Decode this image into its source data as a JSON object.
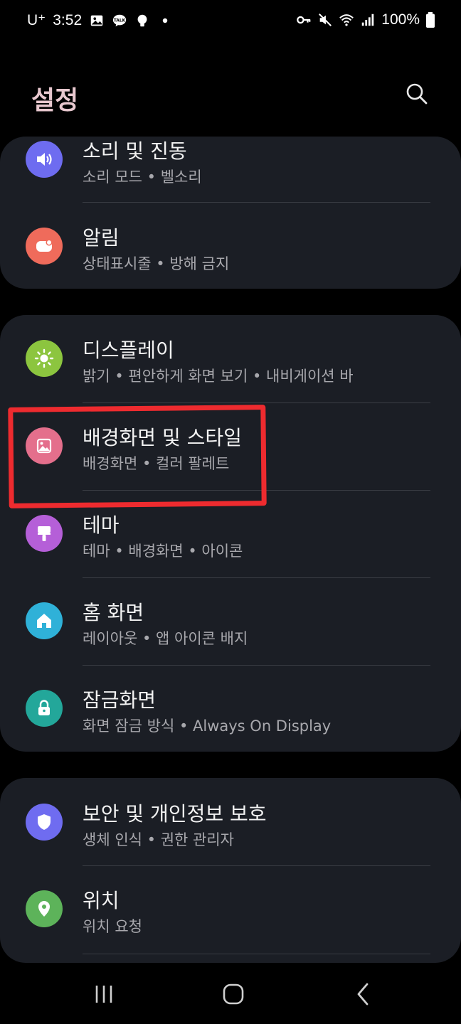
{
  "status_bar": {
    "carrier": "U⁺",
    "time": "3:52",
    "battery": "100%",
    "left_icons": [
      "gallery-icon",
      "kakaotalk-icon",
      "bulb-icon",
      "dot-icon"
    ],
    "right_icons": [
      "key-icon",
      "mute-icon",
      "wifi-icon",
      "signal-icon",
      "battery-icon"
    ],
    "kakao_label": "TALK"
  },
  "header": {
    "title": "설정",
    "search_icon": "search-icon"
  },
  "groups": [
    {
      "items": [
        {
          "title": "소리 및 진동",
          "subtitle": "소리 모드 • 벨소리",
          "icon": "sound-icon",
          "color": "#6e6cf0"
        },
        {
          "title": "알림",
          "subtitle": "상태표시줄 • 방해 금지",
          "icon": "notification-icon",
          "color": "#ef6b5b"
        }
      ]
    },
    {
      "items": [
        {
          "title": "디스플레이",
          "subtitle": "밝기 • 편안하게 화면 보기 • 내비게이션 바",
          "icon": "display-icon",
          "color": "#8cc53f"
        },
        {
          "title": "배경화면 및 스타일",
          "subtitle": "배경화면 • 컬러 팔레트",
          "icon": "wallpaper-icon",
          "color": "#e46f8c"
        },
        {
          "title": "테마",
          "subtitle": "테마 • 배경화면 • 아이콘",
          "icon": "theme-icon",
          "color": "#b55fd8"
        },
        {
          "title": "홈 화면",
          "subtitle": "레이아웃 • 앱 아이콘 배지",
          "icon": "home-icon",
          "color": "#2fb1d8"
        },
        {
          "title": "잠금화면",
          "subtitle": "화면 잠금 방식 • Always On Display",
          "icon": "lock-icon",
          "color": "#23a79a"
        }
      ]
    },
    {
      "items": [
        {
          "title": "보안 및 개인정보 보호",
          "subtitle": "생체 인식 • 권한 관리자",
          "icon": "shield-icon",
          "color": "#6f6cf0"
        },
        {
          "title": "위치",
          "subtitle": "위치 요청",
          "icon": "location-icon",
          "color": "#5db35a"
        }
      ]
    }
  ],
  "nav_bar": {
    "buttons": [
      "recent-apps-icon",
      "home-button-icon",
      "back-icon"
    ]
  },
  "highlight_color": "#ee2b2f"
}
